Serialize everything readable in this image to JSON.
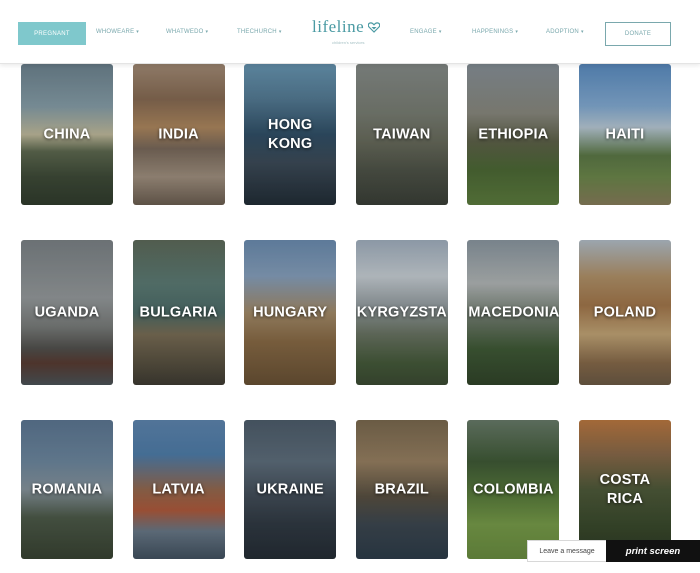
{
  "header": {
    "pregnant_label": "PREGNANT",
    "nav_left": [
      {
        "label": "WHOWEARE"
      },
      {
        "label": "WHATWEDO"
      },
      {
        "label": "THECHURCH"
      }
    ],
    "logo_text": "lifeline",
    "logo_tagline": "children's services",
    "nav_right": [
      {
        "label": "ENGAGE"
      },
      {
        "label": "HAPPENINGS"
      },
      {
        "label": "ADOPTION"
      }
    ],
    "donate_label": "DONATE",
    "accent_color": "#7fc8cc",
    "nav_color": "#7aa8ad"
  },
  "countries": [
    {
      "label": "CHINA"
    },
    {
      "label": "INDIA"
    },
    {
      "label": "HONG\nKONG"
    },
    {
      "label": "TAIWAN"
    },
    {
      "label": "ETHIOPIA"
    },
    {
      "label": "HAITI"
    },
    {
      "label": "UGANDA"
    },
    {
      "label": "BULGARIA"
    },
    {
      "label": "HUNGARY"
    },
    {
      "label": "KYRGYZSTA"
    },
    {
      "label": "MACEDONIA"
    },
    {
      "label": "POLAND"
    },
    {
      "label": "ROMANIA"
    },
    {
      "label": "LATVIA"
    },
    {
      "label": "UKRAINE"
    },
    {
      "label": "BRAZIL"
    },
    {
      "label": "COLOMBIA"
    },
    {
      "label": "COSTA\nRICA"
    }
  ],
  "chat": {
    "message_label": "Leave a message",
    "print_screen_label": "print screen"
  }
}
